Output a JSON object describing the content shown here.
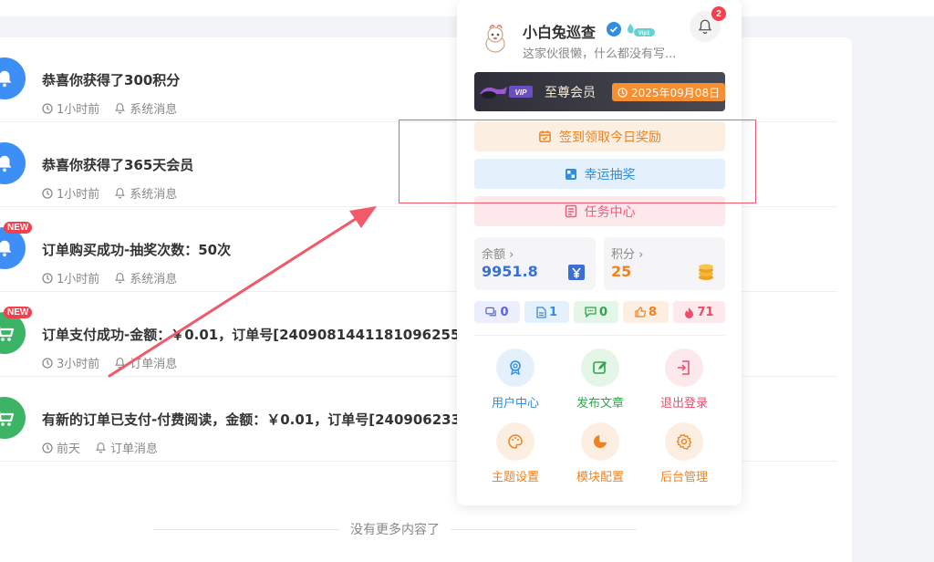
{
  "messages": [
    {
      "title": "恭喜你获得了300积分",
      "time": "1小时前",
      "category": "系统消息",
      "is_new": false,
      "avatar_color": "#3d8ef5",
      "icon": "bell-icon"
    },
    {
      "title": "恭喜你获得了365天会员",
      "time": "1小时前",
      "category": "系统消息",
      "is_new": false,
      "avatar_color": "#3d8ef5",
      "icon": "bell-icon"
    },
    {
      "title": "订单购买成功-抽奖次数：50次",
      "time": "1小时前",
      "category": "系统消息",
      "is_new": true,
      "new_label": "NEW",
      "avatar_color": "#3d8ef5",
      "icon": "bell-icon"
    },
    {
      "title": "订单支付成功-金额：￥0.01，订单号[2409081441181096255]",
      "time": "3小时前",
      "category": "订单消息",
      "is_new": true,
      "new_label": "NEW",
      "avatar_color": "#3cb465",
      "icon": "cart-icon"
    },
    {
      "title": "有新的订单已支付-付费阅读，金额：￥0.01，订单号[240906233",
      "time": "前天",
      "category": "订单消息",
      "is_new": false,
      "avatar_color": "#3cb465",
      "icon": "cart-icon"
    }
  ],
  "no_more_text": "没有更多内容了",
  "user": {
    "name": "小白兔巡查",
    "signature": "这家伙很懒，什么都没有写...",
    "notification_count": "2"
  },
  "vip": {
    "tag": "VIP",
    "label": "至尊会员",
    "expiry": "2025年09月08日"
  },
  "actions": {
    "sign_in": "签到领取今日奖励",
    "lottery": "幸运抽奖",
    "task_center": "任务中心"
  },
  "wallet": {
    "balance_label": "余额",
    "balance_value": "9951.8",
    "points_label": "积分",
    "points_value": "25"
  },
  "counters": [
    "0",
    "1",
    "0",
    "8",
    "71"
  ],
  "menu": [
    {
      "label": "用户中心",
      "icon": "user-badge-icon",
      "color": "blue"
    },
    {
      "label": "发布文章",
      "icon": "edit-icon",
      "color": "green"
    },
    {
      "label": "退出登录",
      "icon": "logout-icon",
      "color": "pink"
    },
    {
      "label": "主题设置",
      "icon": "palette-icon",
      "color": "orange"
    },
    {
      "label": "模块配置",
      "icon": "pie-chart-icon",
      "color": "orange"
    },
    {
      "label": "后台管理",
      "icon": "gear-icon",
      "color": "orange"
    }
  ],
  "colors": {
    "accent_blue": "#3d8ef5",
    "accent_green": "#3cb465",
    "badge_red": "#f2414c",
    "highlight_box": "#f05a6a"
  }
}
